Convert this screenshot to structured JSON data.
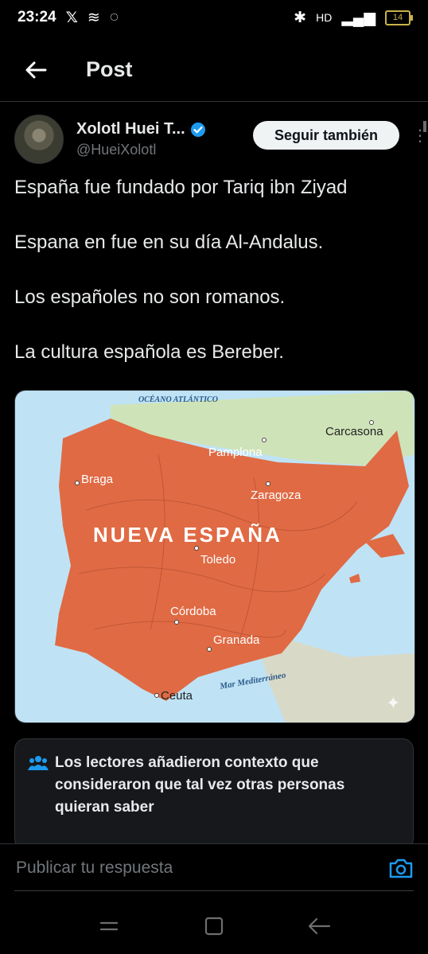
{
  "status_bar": {
    "time": "23:24",
    "network": "HD",
    "battery": "14"
  },
  "app_bar": {
    "title": "Post"
  },
  "author": {
    "display_name": "Xolotl Huei T...",
    "handle": "@HueiXolotl",
    "follow_label": "Seguir también"
  },
  "post": {
    "lines": [
      "España fue fundado por Tariq ibn Ziyad",
      "Espana en fue en su día Al-Andalus.",
      "Los españoles no son romanos.",
      "La cultura española es Bereber."
    ]
  },
  "map": {
    "title": "NUEVA ESPAÑA",
    "ocean_label": "OCÉANO ATLÁNTICO",
    "sea_label": "Mar Mediterráneo",
    "cities": [
      "Carcasona",
      "Pamplona",
      "Braga",
      "Zaragoza",
      "Toledo",
      "Córdoba",
      "Granada",
      "Ceuta"
    ]
  },
  "community_note": {
    "text": "Los lectores añadieron contexto que consideraron que tal vez otras personas quieran saber"
  },
  "reply": {
    "placeholder": "Publicar tu respuesta"
  },
  "colors": {
    "accent": "#1d9bf0",
    "land": "#e06a44",
    "sea": "#bfe3f5"
  }
}
